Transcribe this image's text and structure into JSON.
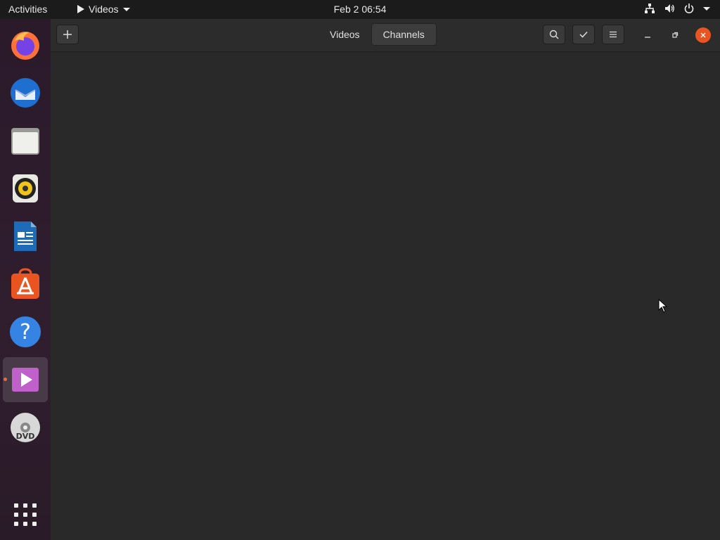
{
  "topbar": {
    "activities": "Activities",
    "app_menu": "Videos",
    "clock": "Feb 2  06:54"
  },
  "dock": {
    "items": [
      {
        "name": "firefox-icon"
      },
      {
        "name": "thunderbird-icon"
      },
      {
        "name": "files-icon"
      },
      {
        "name": "rhythmbox-icon"
      },
      {
        "name": "libreoffice-writer-icon"
      },
      {
        "name": "software-center-icon"
      },
      {
        "name": "help-icon"
      },
      {
        "name": "videos-icon",
        "active": true
      },
      {
        "name": "dvd-icon"
      },
      {
        "name": "show-applications-icon"
      }
    ]
  },
  "window": {
    "tabs": [
      {
        "label": "Videos"
      },
      {
        "label": "Channels",
        "selected": true
      }
    ]
  },
  "colors": {
    "accent": "#e95420",
    "background": "#292929"
  }
}
